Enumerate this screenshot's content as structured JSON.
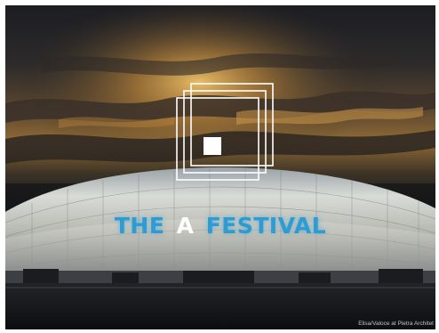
{
  "title": {
    "word1": "THE",
    "word2": "A",
    "word3": "FESTIVAL"
  },
  "photo_credit": "Elisa/Valoce at Pietra Architet",
  "colors": {
    "title_accent": "#2e9bd3",
    "title_center": "#ffffff",
    "logo": "#ffffff",
    "sky_glow": "#e7b14a"
  },
  "logo": {
    "icon": "nested-squares-icon"
  }
}
